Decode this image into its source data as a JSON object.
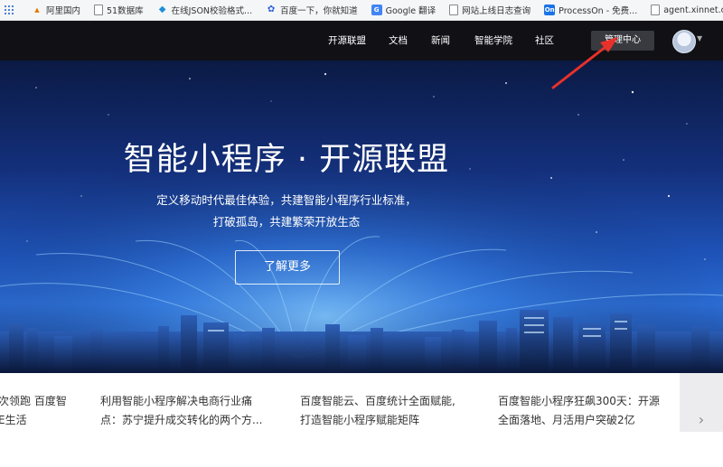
{
  "bookmarks": [
    {
      "label": "",
      "icon": "app-grid-icon"
    },
    {
      "label": "阿里国内",
      "icon": "pma-icon"
    },
    {
      "label": "51数据库",
      "icon": "page-icon"
    },
    {
      "label": "在线JSON校验格式...",
      "icon": "json-diamond-icon"
    },
    {
      "label": "百度一下，你就知道",
      "icon": "baidu-paw-icon"
    },
    {
      "label": "Google 翻译",
      "icon": "google-translate-icon"
    },
    {
      "label": "网站上线日志查询",
      "icon": "page-icon"
    },
    {
      "label": "ProcessOn - 免费...",
      "icon": "processon-icon"
    },
    {
      "label": "agent.xinnet.com/...",
      "icon": "page-icon"
    }
  ],
  "nav": {
    "items": [
      "开源联盟",
      "文档",
      "新闻",
      "智能学院",
      "社区"
    ],
    "admin_label": "管理中心"
  },
  "hero": {
    "title": "智能小程序 · 开源联盟",
    "subtitle_line1": "定义移动时代最佳体验，共建智能小程序行业标准，",
    "subtitle_line2": "打破孤岛，共建繁荣开放生态",
    "button_label": "了解更多"
  },
  "news": [
    {
      "line1": "次领跑 百度智",
      "line2": "E生活"
    },
    {
      "line1": "利用智能小程序解决电商行业痛",
      "line2": "点：苏宁提升成交转化的两个方..."
    },
    {
      "line1": "百度智能云、百度统计全面赋能,",
      "line2": "打造智能小程序赋能矩阵"
    },
    {
      "line1": "百度智能小程序狂飙300天：开源",
      "line2": "全面落地、月活用户突破2亿"
    }
  ],
  "colors": {
    "navbar": "#101015",
    "admin_button": "#383a3f",
    "annotation_arrow": "#e8312a",
    "hero_blue": "#1e53b8"
  }
}
